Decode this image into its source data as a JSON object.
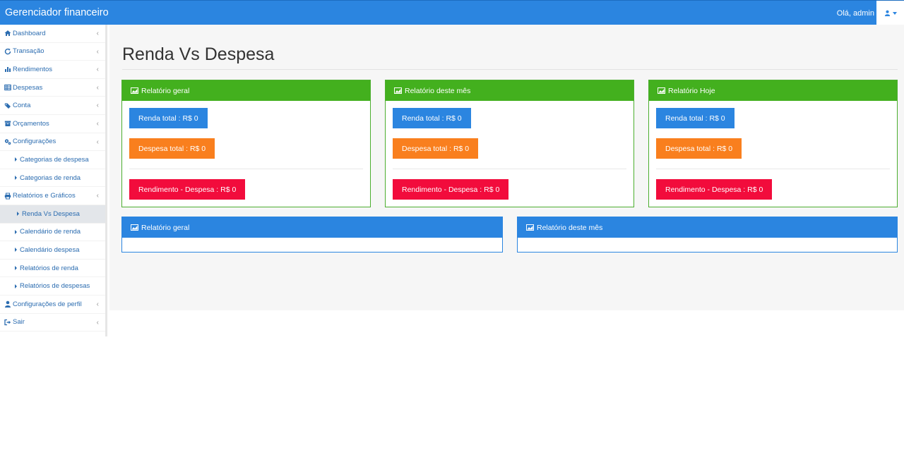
{
  "header": {
    "brand": "Gerenciador financeiro",
    "greeting": "Olá, admin"
  },
  "sidebar": {
    "items": [
      {
        "label": "Dashboard"
      },
      {
        "label": "Transação"
      },
      {
        "label": "Rendimentos"
      },
      {
        "label": "Despesas"
      },
      {
        "label": "Conta"
      },
      {
        "label": "Orçamentos"
      },
      {
        "label": "Configurações"
      },
      {
        "label": "Categorias de despesa"
      },
      {
        "label": "Categorias de renda"
      },
      {
        "label": "Relatórios e Gráficos"
      },
      {
        "label": "Renda Vs Despesa"
      },
      {
        "label": "Calendário de renda"
      },
      {
        "label": "Calendário despesa"
      },
      {
        "label": "Relatórios de renda"
      },
      {
        "label": "Relatórios de despesas"
      },
      {
        "label": "Configurações de perfil"
      },
      {
        "label": "Sair"
      }
    ]
  },
  "main": {
    "title": "Renda Vs Despesa",
    "summary_panels": [
      {
        "title": "Relatório geral",
        "income": "Renda total : R$ 0",
        "expense": "Despesa total : R$ 0",
        "result": "Rendimento - Despesa : R$ 0"
      },
      {
        "title": "Relatório deste mês",
        "income": "Renda total : R$ 0",
        "expense": "Despesa total : R$ 0",
        "result": "Rendimento - Despesa : R$ 0"
      },
      {
        "title": "Relatório Hoje",
        "income": "Renda total : R$ 0",
        "expense": "Despesa total : R$ 0",
        "result": "Rendimento - Despesa : R$ 0"
      }
    ],
    "chart_panels": [
      {
        "title": "Relatório geral"
      },
      {
        "title": "Relatório deste mês"
      }
    ]
  },
  "colors": {
    "primary": "#2b85e0",
    "success": "#43b01e",
    "warning": "#f97f1e",
    "danger": "#f20c3c"
  }
}
